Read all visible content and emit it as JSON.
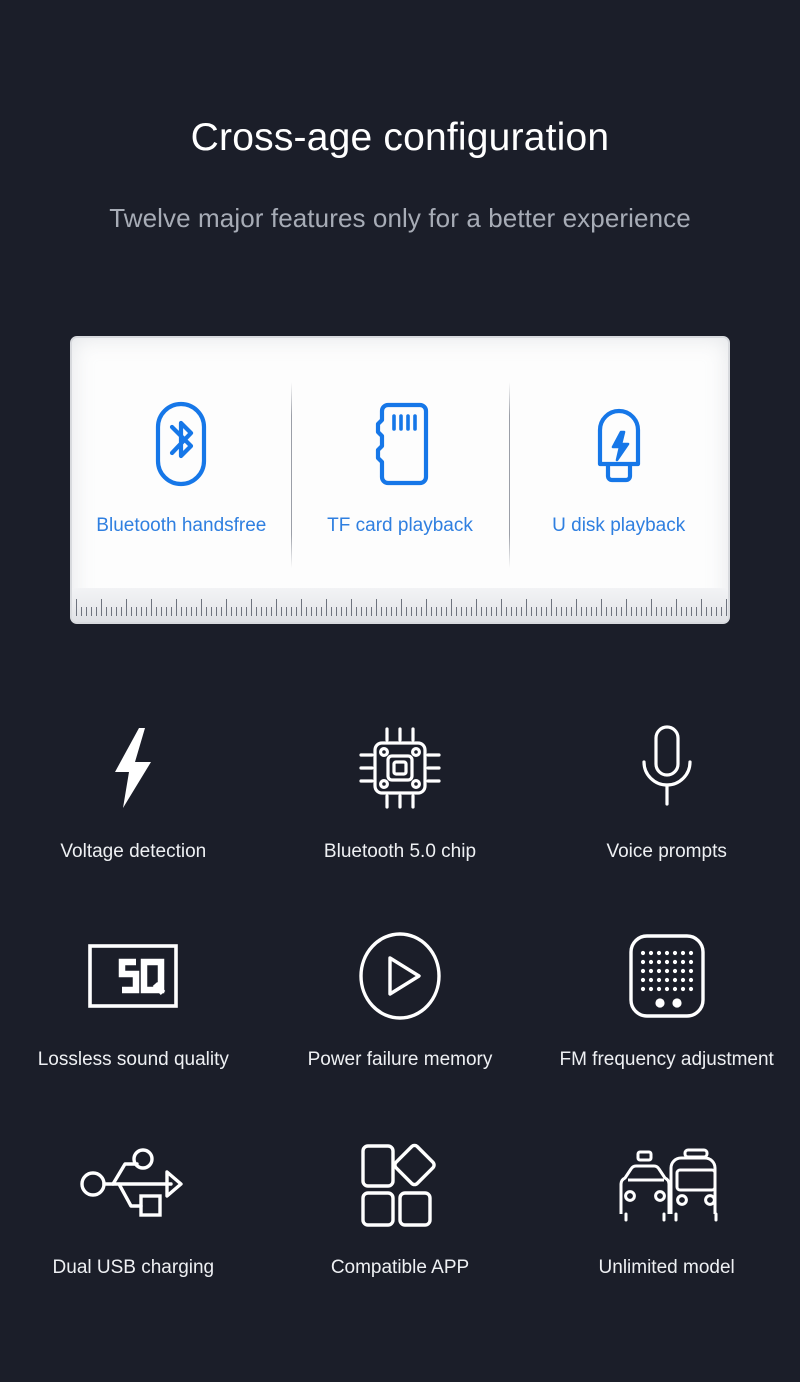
{
  "header": {
    "title": "Cross-age configuration",
    "subtitle": "Twelve major features only for a better experience"
  },
  "colors": {
    "background": "#1b1e29",
    "card_background": "#fdfdfd",
    "accent_blue": "#1677e8",
    "label_blue": "#2f7fe0",
    "title_white": "#ffffff",
    "subtitle_gray": "#a7acb6"
  },
  "card": {
    "items": [
      {
        "icon": "bluetooth-icon",
        "label": "Bluetooth handsfree"
      },
      {
        "icon": "tf-card-icon",
        "label": "TF card playback"
      },
      {
        "icon": "usb-drive-icon",
        "label": "U disk playback"
      }
    ]
  },
  "features": [
    {
      "icon": "lightning-bolt-icon",
      "label": "Voltage detection"
    },
    {
      "icon": "chip-icon",
      "label": "Bluetooth 5.0 chip"
    },
    {
      "icon": "microphone-icon",
      "label": "Voice prompts"
    },
    {
      "icon": "sq-badge-icon",
      "label": "Lossless sound quality",
      "badge_text": "SQ"
    },
    {
      "icon": "play-circle-icon",
      "label": "Power failure memory"
    },
    {
      "icon": "radio-speaker-icon",
      "label": "FM frequency adjustment"
    },
    {
      "icon": "usb-trident-icon",
      "label": "Dual USB charging"
    },
    {
      "icon": "app-shapes-icon",
      "label": "Compatible APP"
    },
    {
      "icon": "car-bus-icon",
      "label": "Unlimited model"
    }
  ]
}
